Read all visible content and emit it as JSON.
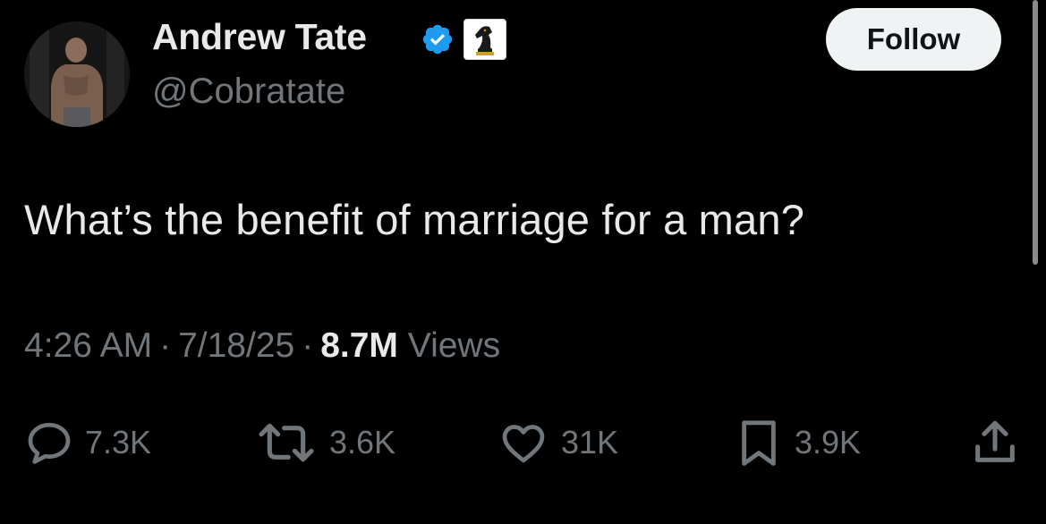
{
  "author": {
    "display_name": "Andrew Tate",
    "handle": "@Cobratate"
  },
  "follow_button": {
    "label": "Follow"
  },
  "tweet": {
    "text": "What’s the benefit of marriage for a man?",
    "time": "4:26 AM",
    "date": "7/18/25",
    "views_count": "8.7M",
    "views_label": "Views",
    "separator": "·"
  },
  "actions": {
    "replies": "7.3K",
    "reposts": "3.6K",
    "likes": "31K",
    "bookmarks": "3.9K"
  },
  "icons": {
    "verified": "verified-badge-icon",
    "affiliate": "chess-knight-affiliate-icon",
    "reply": "reply-icon",
    "repost": "repost-icon",
    "like": "heart-icon",
    "bookmark": "bookmark-icon",
    "share": "share-icon"
  },
  "colors": {
    "background": "#000000",
    "primary_text": "#e7e9ea",
    "secondary_text": "#71767b",
    "verified_blue": "#1d9bf0",
    "follow_bg": "#eff3f4",
    "follow_text": "#0f1419"
  }
}
